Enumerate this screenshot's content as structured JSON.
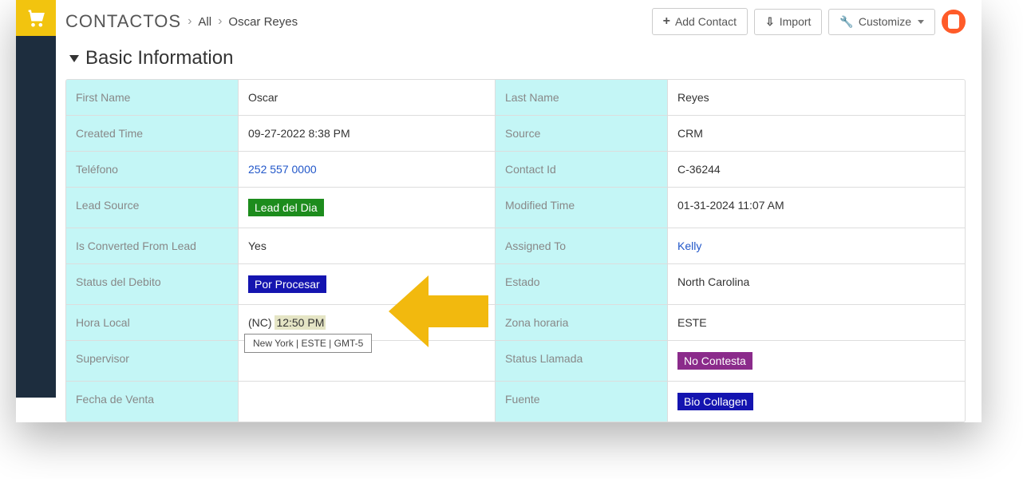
{
  "breadcrumb": {
    "module": "Contactos",
    "all": "All",
    "record": "Oscar Reyes"
  },
  "actions": {
    "add": "Add Contact",
    "import": "Import",
    "customize": "Customize"
  },
  "section": {
    "title": "Basic Information"
  },
  "fields": {
    "first_name_label": "First Name",
    "first_name_value": "Oscar",
    "last_name_label": "Last Name",
    "last_name_value": "Reyes",
    "created_time_label": "Created Time",
    "created_time_value": "09-27-2022 8:38 PM",
    "source_label": "Source",
    "source_value": "CRM",
    "telefono_label": "Teléfono",
    "telefono_value": "252 557 0000",
    "contact_id_label": "Contact Id",
    "contact_id_value": "C-36244",
    "lead_source_label": "Lead Source",
    "lead_source_value": "Lead del Dia",
    "modified_time_label": "Modified Time",
    "modified_time_value": "01-31-2024 11:07 AM",
    "is_converted_label": "Is Converted From Lead",
    "is_converted_value": "Yes",
    "assigned_to_label": "Assigned To",
    "assigned_to_value": "Kelly",
    "status_debito_label": "Status del Debito",
    "status_debito_value": "Por Procesar",
    "estado_label": "Estado",
    "estado_value": "North Carolina",
    "hora_local_label": "Hora Local",
    "hora_local_prefix": "(NC) ",
    "hora_local_time": "12:50 PM",
    "hora_local_tooltip": "New York | ESTE | GMT-5",
    "zona_horaria_label": "Zona horaria",
    "zona_horaria_value": "ESTE",
    "supervisor_label": "Supervisor",
    "supervisor_value": "",
    "status_llamada_label": "Status Llamada",
    "status_llamada_value": "No Contesta",
    "fecha_venta_label": "Fecha de Venta",
    "fecha_venta_value": "",
    "fuente_label": "Fuente",
    "fuente_value": "Bio Collagen"
  }
}
